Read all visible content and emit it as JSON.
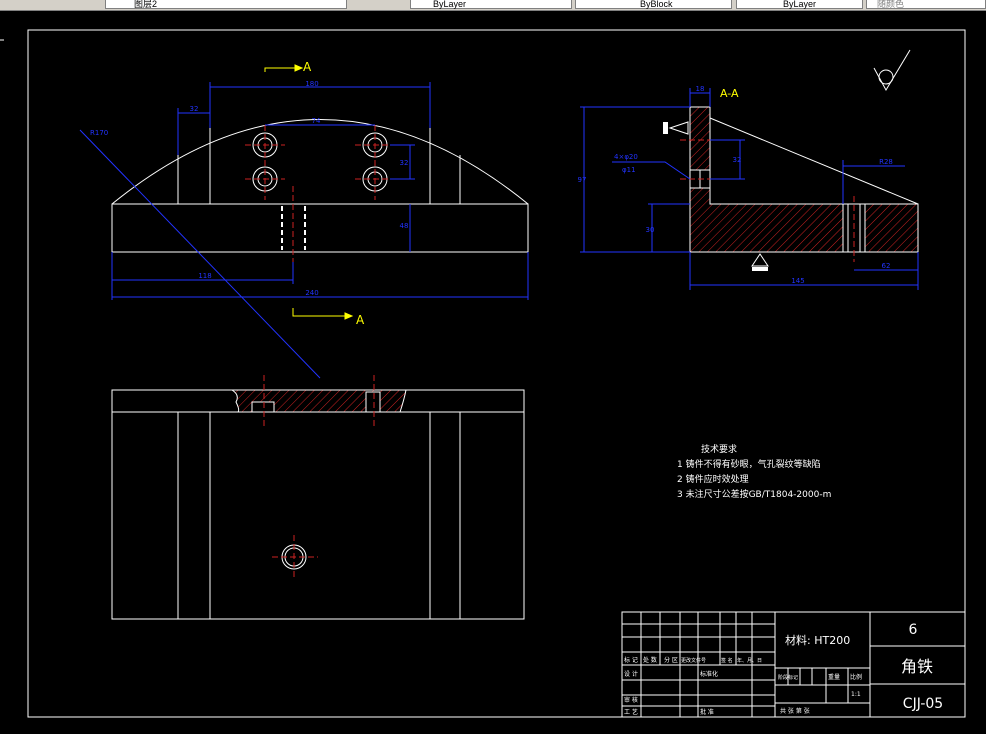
{
  "toolbar": {
    "layer_name": "图层2",
    "color_control": "ByLayer",
    "linetype_control": "ByBlock",
    "lineweight_control": "ByLayer",
    "plotstyle_control": "随颜色"
  },
  "drawing": {
    "section_label": "A",
    "section_view_label": "A-A",
    "dims_front": {
      "top_width": "180",
      "hole_spacing": "74",
      "left_offset": "32",
      "hole_pitch_v": "32",
      "base_height": "48",
      "left_to_center": "118",
      "total_width": "240",
      "radius": "R170"
    },
    "dims_side": {
      "top_thick": "18",
      "hole_label": "4×φ20",
      "hole_sub": "φ11",
      "v_32": "32",
      "total_height": "97",
      "base_h": "30",
      "right_w": "R28",
      "bottom_right": "62",
      "total_len": "145"
    }
  },
  "tech_requirements": {
    "title": "技术要求",
    "items": [
      "1  铸件不得有砂眼，气孔裂纹等缺陷",
      "2  铸件应时效处理",
      "3  未注尺寸公差按GB/T1804-2000-m"
    ]
  },
  "title_block": {
    "material": "材料: HT200",
    "quantity": "6",
    "part_name": "角铁",
    "drawing_no": "CJJ-05",
    "revision_row": [
      "标 记",
      "处 数",
      "分 区",
      "更改文件号",
      "签 名",
      "年、月、日"
    ],
    "design_label": "设 计",
    "standardization": "标准化",
    "stage_mark": "阶段标记",
    "weight": "重量",
    "scale": "比例",
    "scale_value": "1:1",
    "review_label": "审 核",
    "process_label": "工 艺",
    "approve_label": "批 准",
    "sheet_row": "共    张  第    张"
  }
}
